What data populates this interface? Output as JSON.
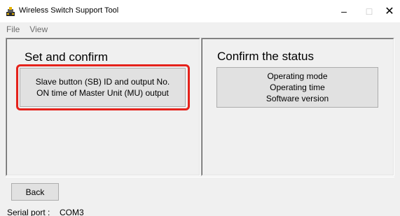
{
  "window": {
    "title": "Wireless Switch Support Tool",
    "controls": {
      "minimize": "–",
      "maximize": "□",
      "close": "✕"
    }
  },
  "menu": {
    "items": [
      "File",
      "View"
    ]
  },
  "left_panel": {
    "title": "Set and confirm",
    "button_lines": [
      "Slave button (SB) ID and output No.",
      "ON time of Master Unit (MU) output"
    ],
    "highlight_color": "#e5221b"
  },
  "right_panel": {
    "title": "Confirm the status",
    "button_lines": [
      "Operating mode",
      "Operating time",
      "Software version"
    ]
  },
  "footer": {
    "back_label": "Back"
  },
  "statusbar": {
    "label": "Serial port :",
    "value": "COM3"
  },
  "icons": {
    "app": "app-icon"
  }
}
